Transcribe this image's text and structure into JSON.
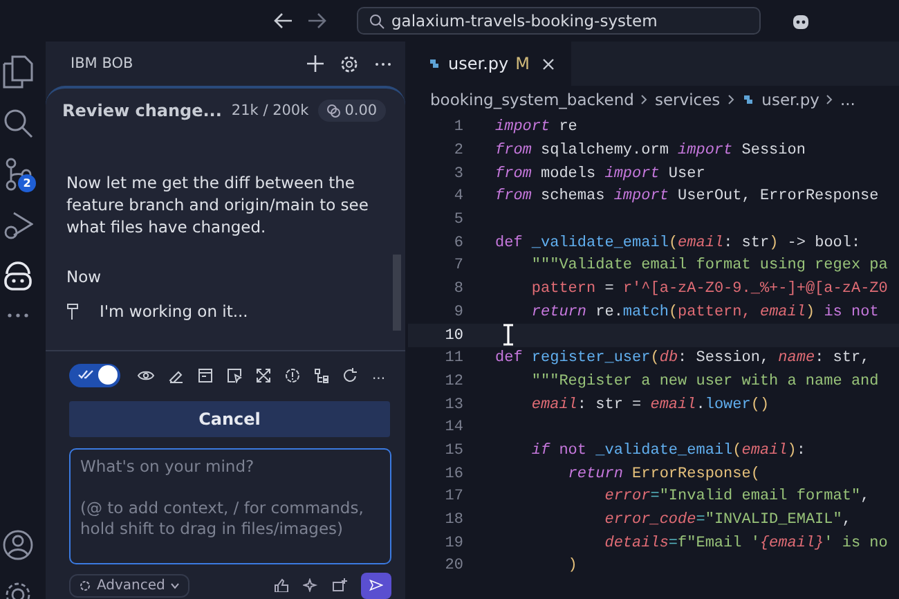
{
  "title_bar": {
    "search": "galaxium-travels-booking-system"
  },
  "activity_bar": {
    "source_control_badge": "2"
  },
  "chat": {
    "header": "IBM BOB",
    "task": {
      "title": "Review change...",
      "tokens": "21k / 200k",
      "cost": "0.00"
    },
    "messages": [
      {
        "kind": "text",
        "text": "Now let me get the diff between the feature branch and origin/main to see what files have changed."
      },
      {
        "kind": "text",
        "text": "Now"
      },
      {
        "kind": "status",
        "text": "I'm working on it..."
      }
    ],
    "toolbar": {
      "auto_approve": {
        "on": true
      },
      "more": "..."
    },
    "cancel": "Cancel",
    "input": {
      "placeholder": "What's on your mind?\n\n(@ to add context, / for commands, hold shift to drag in files/images)"
    },
    "mode": "Advanced"
  },
  "editor": {
    "tabs": [
      {
        "label": "user.py",
        "badge": "M",
        "selected": true
      }
    ],
    "breadcrumb": [
      "booking_system_backend",
      "services",
      "user.py",
      "..."
    ],
    "lines": [
      {
        "number": "1",
        "current": false,
        "tokens": [
          {
            "text": "import",
            "kind": "keyword"
          },
          {
            "text": " re",
            "kind": "plain"
          }
        ]
      },
      {
        "number": "2",
        "current": false,
        "tokens": [
          {
            "text": "from",
            "kind": "keyword"
          },
          {
            "text": " sqlalchemy.orm ",
            "kind": "plain"
          },
          {
            "text": "import",
            "kind": "keyword"
          },
          {
            "text": " Session",
            "kind": "plain"
          }
        ]
      },
      {
        "number": "3",
        "current": false,
        "tokens": [
          {
            "text": "from",
            "kind": "keyword"
          },
          {
            "text": " models ",
            "kind": "plain"
          },
          {
            "text": "import",
            "kind": "keyword"
          },
          {
            "text": " User",
            "kind": "plain"
          }
        ]
      },
      {
        "number": "4",
        "current": false,
        "tokens": [
          {
            "text": "from",
            "kind": "keyword"
          },
          {
            "text": " schemas ",
            "kind": "plain"
          },
          {
            "text": "import",
            "kind": "keyword"
          },
          {
            "text": " UserOut, ErrorResponse",
            "kind": "plain"
          }
        ]
      },
      {
        "number": "5",
        "current": false
      },
      {
        "number": "6",
        "current": false,
        "tokens": [
          {
            "text": "def",
            "kind": "def"
          },
          {
            "text": " _validate_email",
            "kind": "function"
          },
          {
            "text": "(",
            "kind": "paren"
          },
          {
            "text": "email",
            "kind": "param"
          },
          {
            "text": ": str",
            "kind": "plain"
          },
          {
            "text": ")",
            "kind": "paren"
          },
          {
            "text": " -> bool:",
            "kind": "plain"
          }
        ]
      },
      {
        "number": "7",
        "current": false,
        "tokens": [
          {
            "text": "    \"\"\"Validate email format using regex pa",
            "kind": "string"
          }
        ]
      },
      {
        "number": "8",
        "current": false,
        "tokens": [
          {
            "text": "    pattern",
            "kind": "variable"
          },
          {
            "text": " = ",
            "kind": "plain"
          },
          {
            "text": "r'^[a-zA-Z0-9._%+-]+@[a-zA-Z0",
            "kind": "regex"
          }
        ]
      },
      {
        "number": "9",
        "current": false,
        "tokens": [
          {
            "text": "    return",
            "kind": "keyword"
          },
          {
            "text": " re.",
            "kind": "plain"
          },
          {
            "text": "match",
            "kind": "function"
          },
          {
            "text": "(",
            "kind": "paren"
          },
          {
            "text": "pattern, ",
            "kind": "variable"
          },
          {
            "text": "email",
            "kind": "param"
          },
          {
            "text": ")",
            "kind": "paren"
          },
          {
            "text": " is not",
            "kind": "def"
          }
        ]
      },
      {
        "number": "10",
        "current": true
      },
      {
        "number": "11",
        "current": false,
        "tokens": [
          {
            "text": "def",
            "kind": "def"
          },
          {
            "text": " register_user",
            "kind": "function"
          },
          {
            "text": "(",
            "kind": "paren"
          },
          {
            "text": "db",
            "kind": "param"
          },
          {
            "text": ": Session, ",
            "kind": "plain"
          },
          {
            "text": "name",
            "kind": "param"
          },
          {
            "text": ": str,",
            "kind": "plain"
          }
        ]
      },
      {
        "number": "12",
        "current": false,
        "tokens": [
          {
            "text": "    \"\"\"Register a new user with a name and",
            "kind": "string"
          }
        ]
      },
      {
        "number": "13",
        "current": false,
        "tokens": [
          {
            "text": "    email",
            "kind": "param"
          },
          {
            "text": ": str = ",
            "kind": "plain"
          },
          {
            "text": "email",
            "kind": "param"
          },
          {
            "text": ".",
            "kind": "plain"
          },
          {
            "text": "lower",
            "kind": "function"
          },
          {
            "text": "()",
            "kind": "paren"
          }
        ]
      },
      {
        "number": "14",
        "current": false
      },
      {
        "number": "15",
        "current": false,
        "tokens": [
          {
            "text": "    if",
            "kind": "keyword"
          },
          {
            "text": " not ",
            "kind": "def"
          },
          {
            "text": "_validate_email",
            "kind": "function"
          },
          {
            "text": "(",
            "kind": "paren"
          },
          {
            "text": "email",
            "kind": "param"
          },
          {
            "text": ")",
            "kind": "paren"
          },
          {
            "text": ":",
            "kind": "plain"
          }
        ]
      },
      {
        "number": "16",
        "current": false,
        "tokens": [
          {
            "text": "        return",
            "kind": "keyword"
          },
          {
            "text": " ErrorResponse",
            "kind": "class"
          },
          {
            "text": "(",
            "kind": "paren"
          }
        ]
      },
      {
        "number": "17",
        "current": false,
        "tokens": [
          {
            "text": "            error",
            "kind": "param"
          },
          {
            "text": "=",
            "kind": "operator"
          },
          {
            "text": "\"Invalid email format\"",
            "kind": "string"
          },
          {
            "text": ",",
            "kind": "plain"
          }
        ]
      },
      {
        "number": "18",
        "current": false,
        "tokens": [
          {
            "text": "            error_code",
            "kind": "param"
          },
          {
            "text": "=",
            "kind": "operator"
          },
          {
            "text": "\"INVALID_EMAIL\"",
            "kind": "string"
          },
          {
            "text": ",",
            "kind": "plain"
          }
        ]
      },
      {
        "number": "19",
        "current": false,
        "tokens": [
          {
            "text": "            details",
            "kind": "param"
          },
          {
            "text": "=",
            "kind": "operator"
          },
          {
            "text": "f\"Email '",
            "kind": "string"
          },
          {
            "text": "{email}",
            "kind": "param"
          },
          {
            "text": "' is no",
            "kind": "string"
          }
        ]
      },
      {
        "number": "20",
        "current": false,
        "tokens": [
          {
            "text": "        )",
            "kind": "paren"
          }
        ]
      }
    ]
  }
}
